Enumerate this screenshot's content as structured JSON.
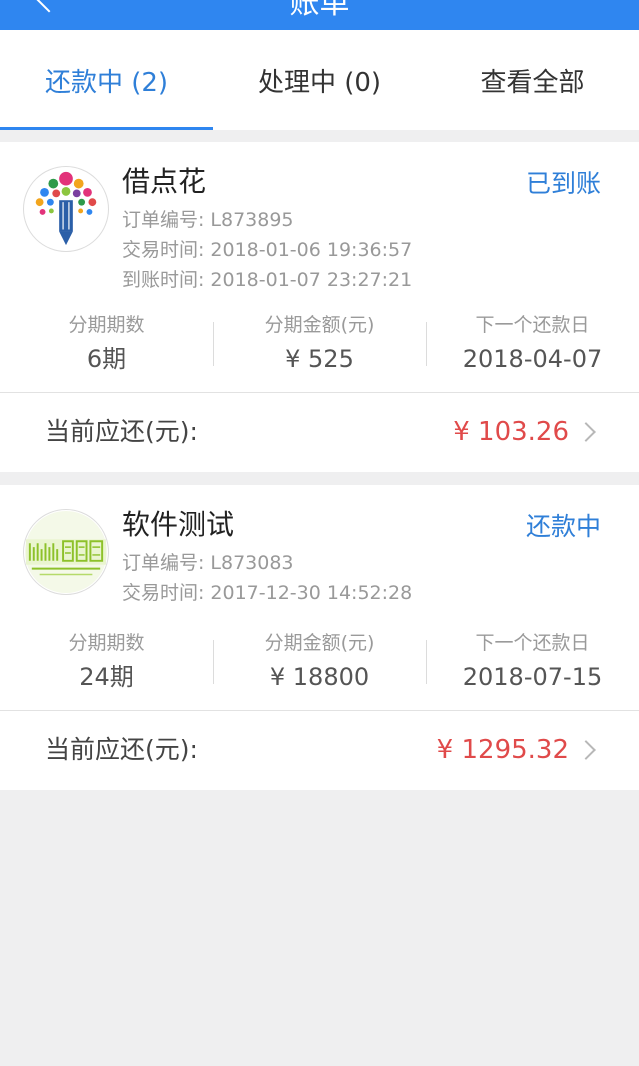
{
  "header": {
    "title": "账单"
  },
  "tabs": [
    {
      "label": "还款中 (2)",
      "active": true
    },
    {
      "label": "处理中 (0)",
      "active": false
    },
    {
      "label": "查看全部",
      "active": false
    }
  ],
  "labels": {
    "order_no": "订单编号:",
    "trade_time": "交易时间:",
    "arrive_time": "到账时间:",
    "periods": "分期期数",
    "amount": "分期金额(元)",
    "next_date": "下一个还款日",
    "current_due": "当前应还(元):"
  },
  "orders": [
    {
      "merchant": "借点花",
      "status": "已到账",
      "order_no": "L873895",
      "trade_time": "2018-01-06 19:36:57",
      "arrive_time": "2018-01-07 23:27:21",
      "periods": "6期",
      "amount": "¥ 525",
      "next_date": "2018-04-07",
      "current_due": "¥ 103.26"
    },
    {
      "merchant": "软件测试",
      "status": "还款中",
      "order_no": "L873083",
      "trade_time": "2017-12-30 14:52:28",
      "periods": "24期",
      "amount": "¥ 18800",
      "next_date": "2018-07-15",
      "current_due": "¥ 1295.32"
    }
  ],
  "colors": {
    "primary": "#2f86f0",
    "link": "#2f7fd8",
    "due": "#e04a4a",
    "background": "#efeff0"
  },
  "icons": {
    "back": "chevron-left-icon",
    "arrow": "chevron-right-icon"
  }
}
